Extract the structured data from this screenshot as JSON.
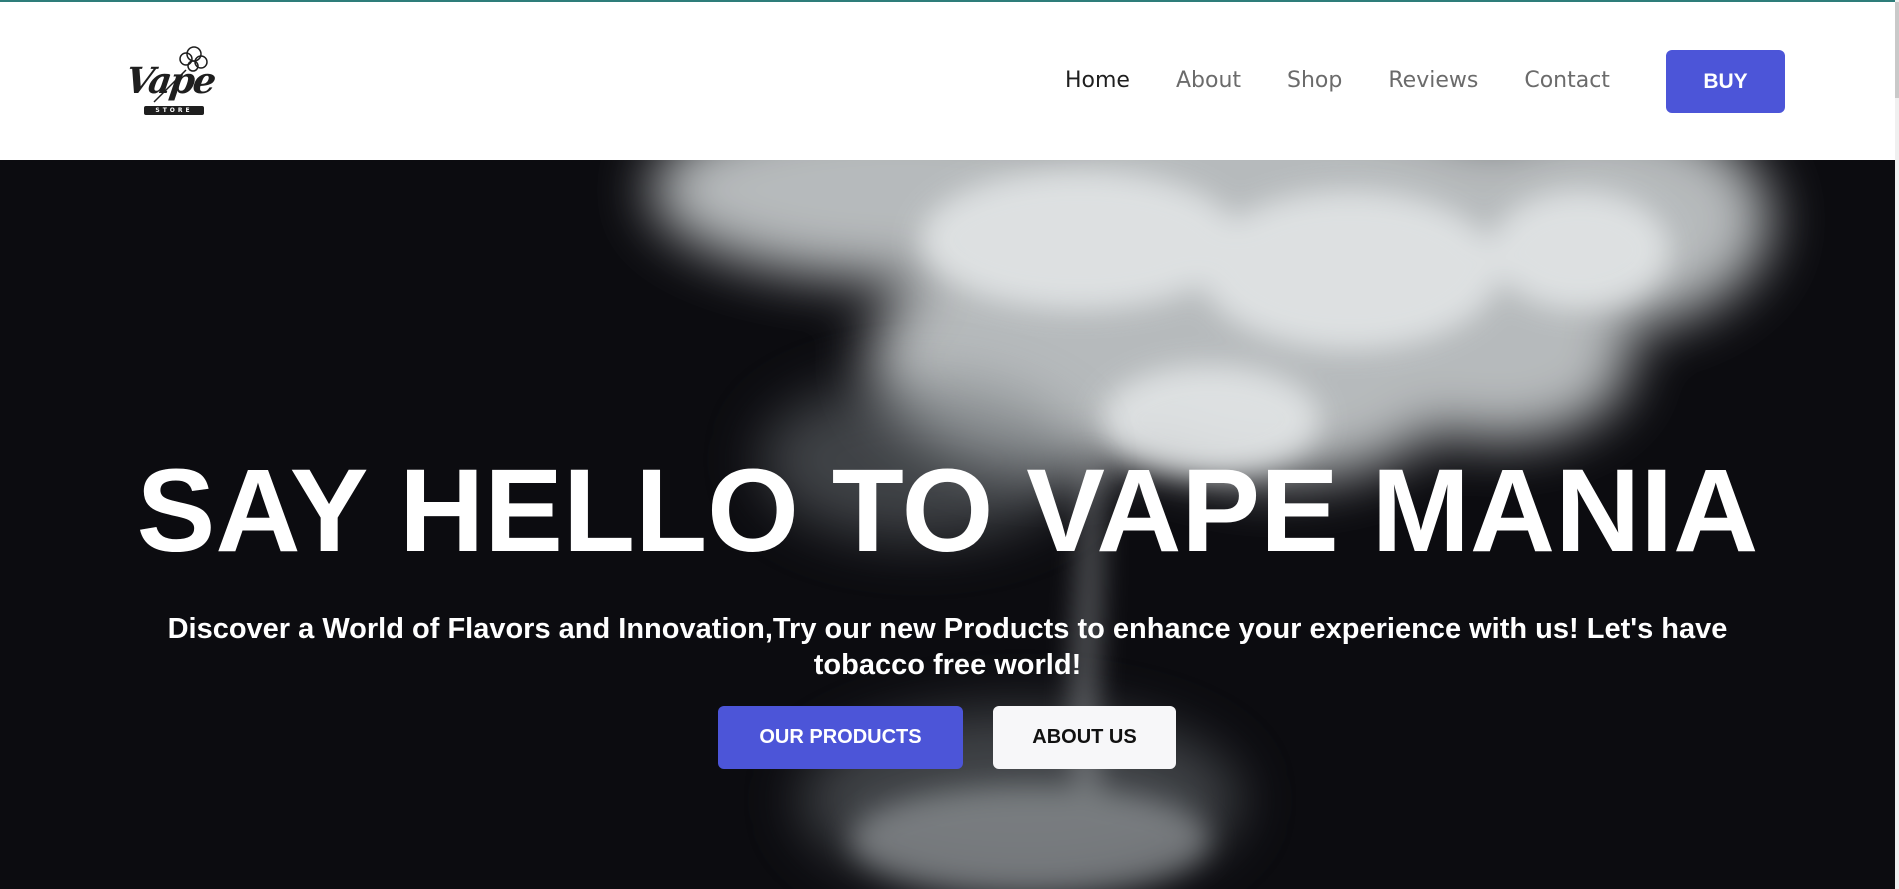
{
  "brand": {
    "logo_text": "Vape",
    "logo_sub": "STORE",
    "accent_color": "#4c55d8",
    "top_bar_color": "#2e7d7a"
  },
  "nav": {
    "items": [
      {
        "label": "Home",
        "active": true
      },
      {
        "label": "About",
        "active": false
      },
      {
        "label": "Shop",
        "active": false
      },
      {
        "label": "Reviews",
        "active": false
      },
      {
        "label": "Contact",
        "active": false
      }
    ],
    "buy_label": "BUY"
  },
  "hero": {
    "title": "SAY HELLO TO VAPE MANIA",
    "subtitle": "Discover a World of Flavors and Innovation,Try our new Products to enhance your experience with us! Let's have tobacco free world!",
    "primary_button": "OUR PRODUCTS",
    "secondary_button": "ABOUT US",
    "background_image": "white-smoke-on-black"
  }
}
